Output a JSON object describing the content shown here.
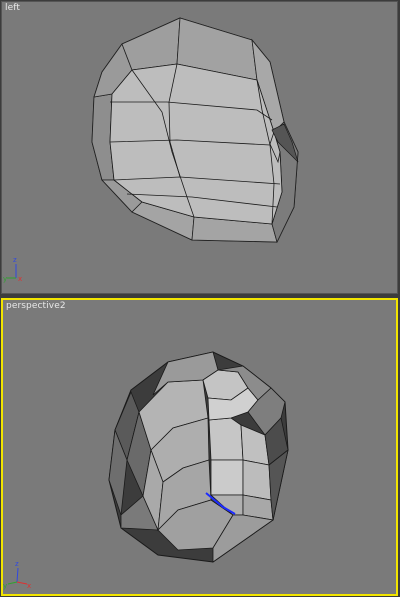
{
  "viewports": {
    "left": {
      "label": "left",
      "active": false
    },
    "perspective": {
      "label": "perspective2",
      "active": true
    }
  },
  "colors": {
    "background": "#7a7a7a",
    "active_border": "#f2e500",
    "mesh_fill": "#b9b9b9",
    "mesh_dark": "#3e3e3e",
    "selected_edge": "#1d2cff",
    "axis_x": "#e03030",
    "axis_y": "#2fa32f",
    "axis_z": "#3048e0"
  },
  "icons": [
    "axis-gizmo-icon",
    "axis-gizmo-icon"
  ]
}
